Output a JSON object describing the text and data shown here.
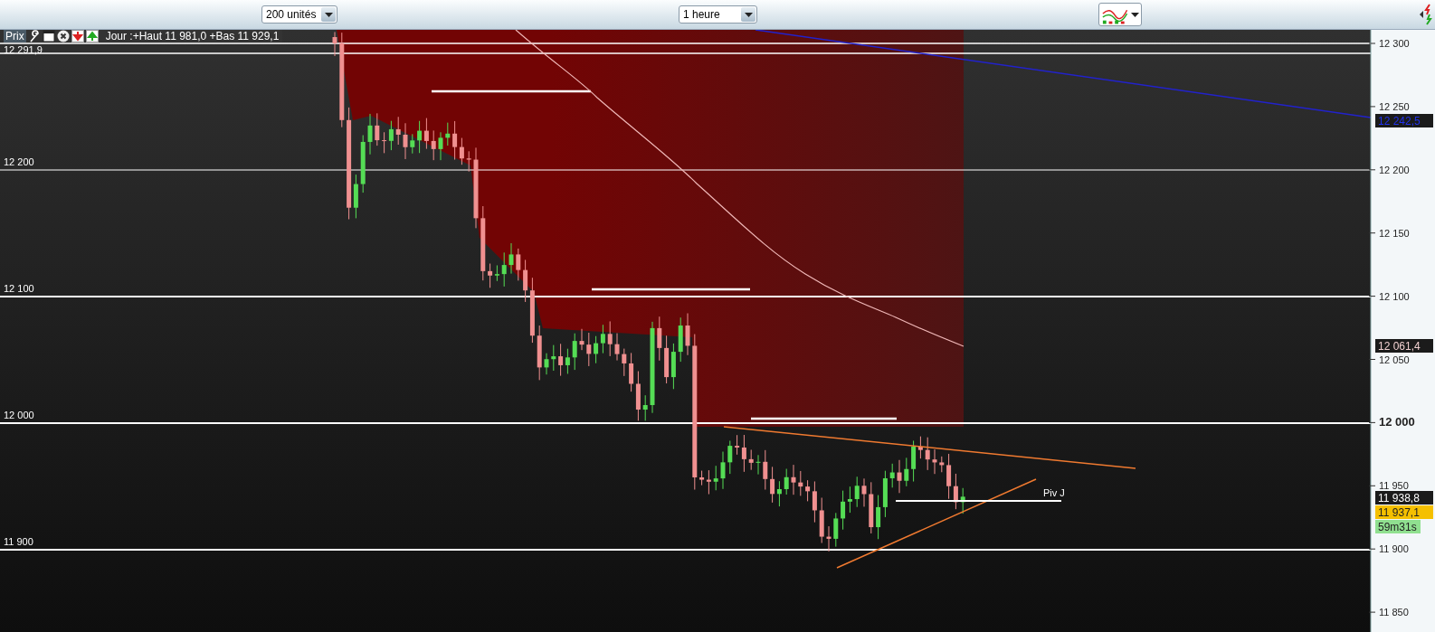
{
  "toolbar": {
    "units_select": {
      "value": "200 unités"
    },
    "period_select": {
      "value": "1 heure"
    }
  },
  "legend": {
    "label": "Prix",
    "text": "Jour :+Haut 11 981,0 +Bas 11 929,1"
  },
  "left_labels": [
    "12 291,9",
    "12 200",
    "12 100",
    "12 000",
    "11 900"
  ],
  "pivot_label": "Piv J",
  "axis_ticks": [
    {
      "label": "12 300",
      "bold": false
    },
    {
      "label": "12 250",
      "bold": false
    },
    {
      "label": "12 200",
      "bold": false
    },
    {
      "label": "12 150",
      "bold": false
    },
    {
      "label": "12 100",
      "bold": false
    },
    {
      "label": "12 050",
      "bold": false
    },
    {
      "label": "12 000",
      "bold": true
    },
    {
      "label": "11 950",
      "bold": false
    },
    {
      "label": "11 900",
      "bold": false
    },
    {
      "label": "11 850",
      "bold": false
    }
  ],
  "badges": [
    {
      "text": "12 242,5",
      "kind": "indicator"
    },
    {
      "text": "12 061,4",
      "kind": "average"
    },
    {
      "text": "11 938,8",
      "kind": "last"
    },
    {
      "text": "11 937,1",
      "kind": "bid"
    },
    {
      "text": "59m31s",
      "kind": "timer"
    }
  ]
}
